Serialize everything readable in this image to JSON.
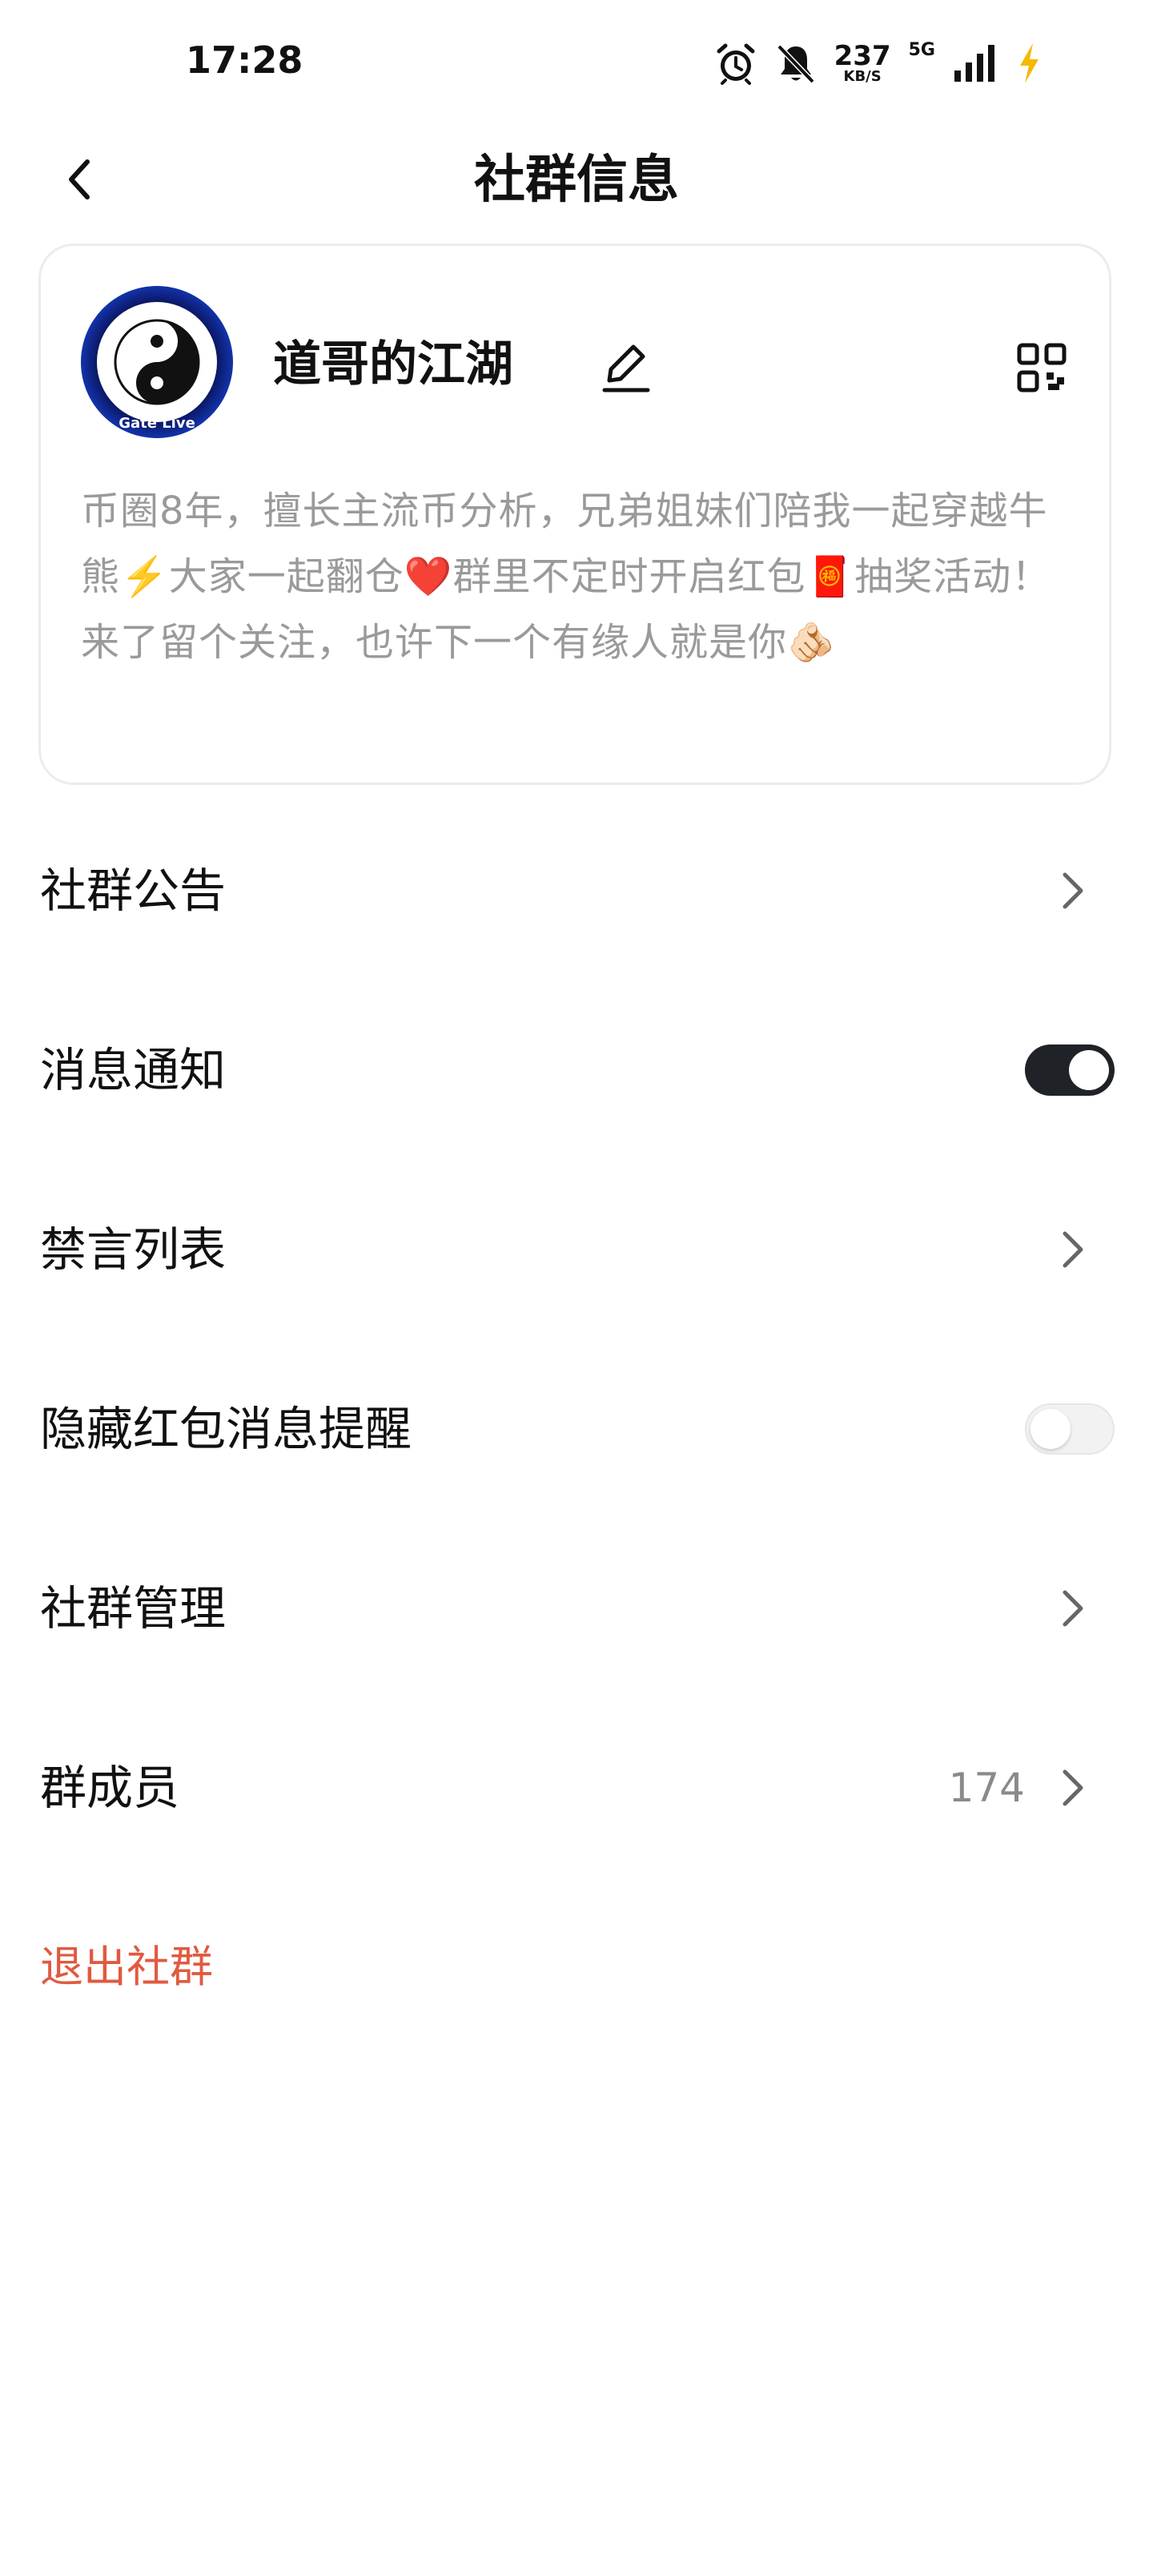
{
  "status_bar": {
    "time": "17:28",
    "net_speed": "237",
    "net_speed_unit": "KB/S",
    "net_type": "5G",
    "icons": [
      "alarm-icon",
      "mute-bell-icon",
      "signal-icon",
      "charging-bolt-icon"
    ],
    "charging_color": "#f5b800"
  },
  "header": {
    "title": "社群信息"
  },
  "card": {
    "name": "道哥的江湖",
    "avatar_caption": "Gate Live",
    "description": "币圈8年，擅长主流币分析，兄弟姐妹们陪我一起穿越牛熊⚡️大家一起翻仓❤️群里不定时开启红包🧧抽奖活动！来了留个关注，也许下一个有缘人就是你🫵🏻"
  },
  "menu": {
    "items": [
      {
        "label": "社群公告",
        "control": "chevron"
      },
      {
        "label": "消息通知",
        "control": "toggle",
        "on": true
      },
      {
        "label": "禁言列表",
        "control": "chevron"
      },
      {
        "label": "隐藏红包消息提醒",
        "control": "toggle",
        "on": false
      },
      {
        "label": "社群管理",
        "control": "chevron"
      },
      {
        "label": "群成员",
        "control": "chevron",
        "count": "174"
      }
    ],
    "exit_label": "退出社群"
  },
  "colors": {
    "exit": "#e05a3f",
    "toggle_on": "#1f2226",
    "description_text": "#9a9a9a"
  }
}
